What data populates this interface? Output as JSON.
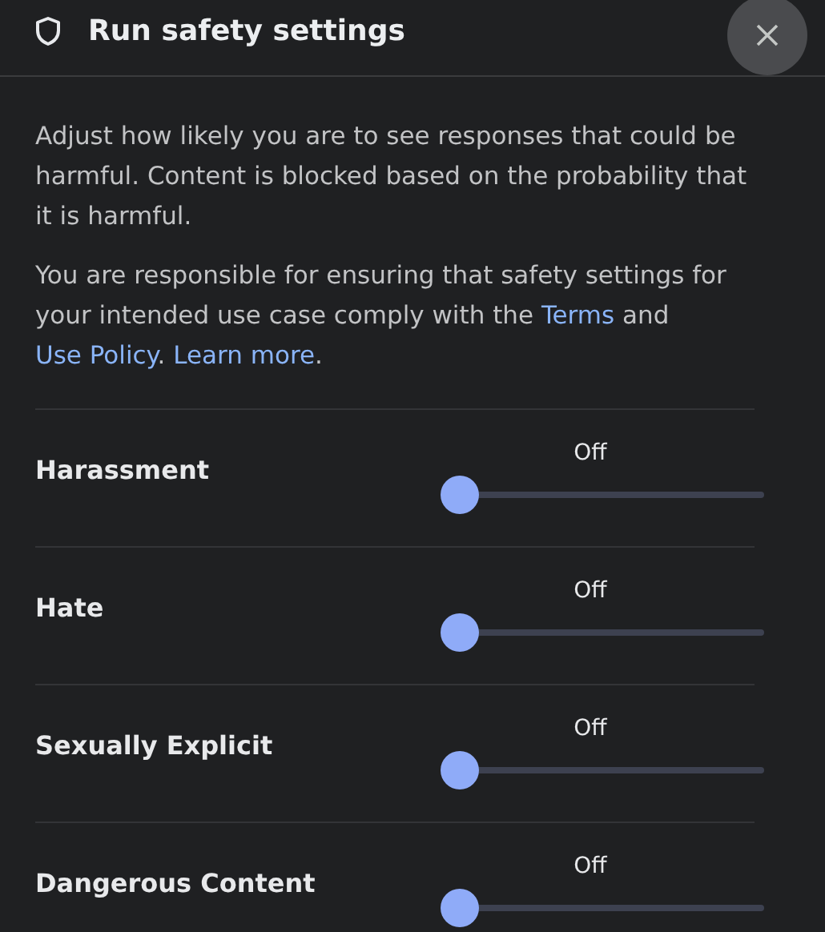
{
  "dialog": {
    "title": "Run safety settings"
  },
  "description": "Adjust how likely you are to see responses that could be harmful. Content is blocked based on the probability that it is harmful.",
  "notice": [
    {
      "kind": "text",
      "text": "You are responsible for ensuring that safety settings for your intended use case comply with the "
    },
    {
      "kind": "link",
      "text": "Terms"
    },
    {
      "kind": "text",
      "text": " and "
    },
    {
      "kind": "link",
      "text": "Use Policy"
    },
    {
      "kind": "text",
      "text": ". "
    },
    {
      "kind": "link",
      "text": "Learn more"
    },
    {
      "kind": "text",
      "text": "."
    }
  ],
  "categories": [
    {
      "name": "Harassment",
      "reading": "Off",
      "level": 0
    },
    {
      "name": "Hate",
      "reading": "Off",
      "level": 0
    },
    {
      "name": "Sexually Explicit",
      "reading": "Off",
      "level": 0
    },
    {
      "name": "Dangerous Content",
      "reading": "Off",
      "level": 0
    }
  ]
}
